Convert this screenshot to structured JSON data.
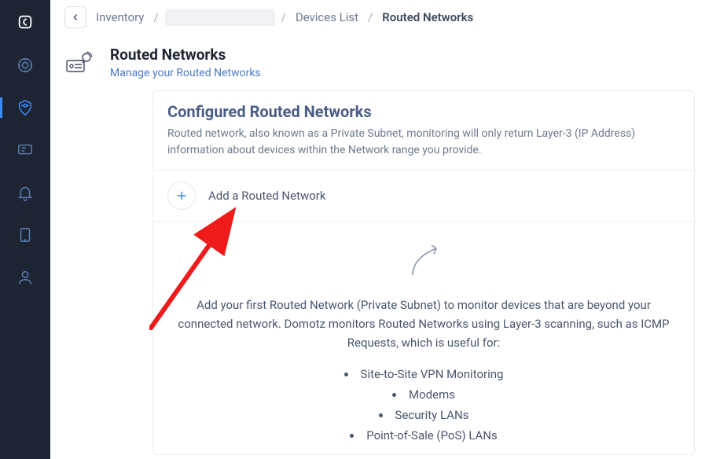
{
  "breadcrumbs": {
    "back_aria": "Back",
    "items": [
      {
        "label": "Inventory"
      },
      {
        "label": ""
      },
      {
        "label": "Devices List"
      },
      {
        "label": "Routed Networks"
      }
    ]
  },
  "header": {
    "title": "Routed Networks",
    "subtitle": "Manage your Routed Networks"
  },
  "card": {
    "title": "Configured Routed Networks",
    "description": "Routed network, also known as a Private Subnet, monitoring will only return Layer-3 (IP Address) information about devices within the Network range you provide.",
    "add_label": "Add a Routed Network",
    "empty_state_text": "Add your first Routed Network (Private Subnet) to monitor devices that are beyond your connected network. Domotz monitors Routed Networks using Layer-3 scanning, such as ICMP Requests, which is useful for:",
    "uses": [
      "Site-to-Site VPN Monitoring",
      "Modems",
      "Security LANs",
      "Point-of-Sale (PoS) LANs"
    ]
  },
  "sidebar": {
    "items": [
      {
        "name": "dashboard-icon"
      },
      {
        "name": "inventory-icon",
        "active": true
      },
      {
        "name": "monitor-icon"
      },
      {
        "name": "alerts-icon"
      },
      {
        "name": "devices-icon"
      },
      {
        "name": "user-icon"
      }
    ]
  }
}
